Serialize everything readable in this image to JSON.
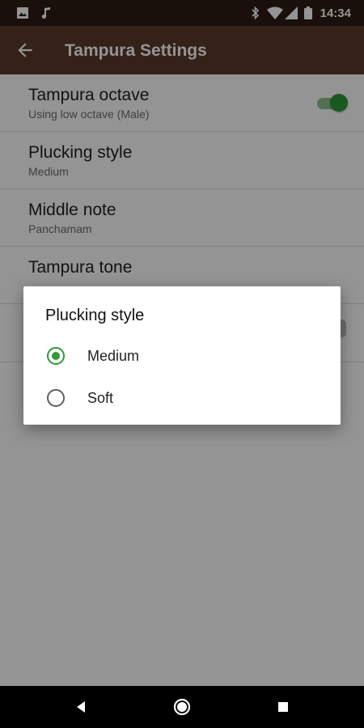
{
  "status_bar": {
    "time": "14:34",
    "icons_left": [
      "image-icon",
      "music-note-icon"
    ],
    "icons_right": [
      "bluetooth-icon",
      "wifi-icon",
      "signal-icon",
      "battery-icon"
    ]
  },
  "app_bar": {
    "title": "Tampura Settings",
    "back_icon": "back-arrow-icon"
  },
  "preferences": [
    {
      "title": "Tampura octave",
      "summary": "Using low octave (Male)",
      "type": "switch",
      "checked": true
    },
    {
      "title": "Plucking style",
      "summary": "Medium",
      "type": "list"
    },
    {
      "title": "Middle note",
      "summary": "Panchamam",
      "type": "list"
    },
    {
      "title": "Tampura tone",
      "summary": "",
      "type": "list"
    }
  ],
  "dialog": {
    "title": "Plucking style",
    "options": [
      {
        "label": "Medium",
        "selected": true
      },
      {
        "label": "Soft",
        "selected": false
      }
    ]
  },
  "colors": {
    "accent": "#2e9a35",
    "app_bar": "#5a3a2a",
    "status_bar": "#2c1d14"
  },
  "nav_bar": {
    "buttons": [
      "back-triangle-icon",
      "home-circle-icon",
      "recents-square-icon"
    ]
  }
}
